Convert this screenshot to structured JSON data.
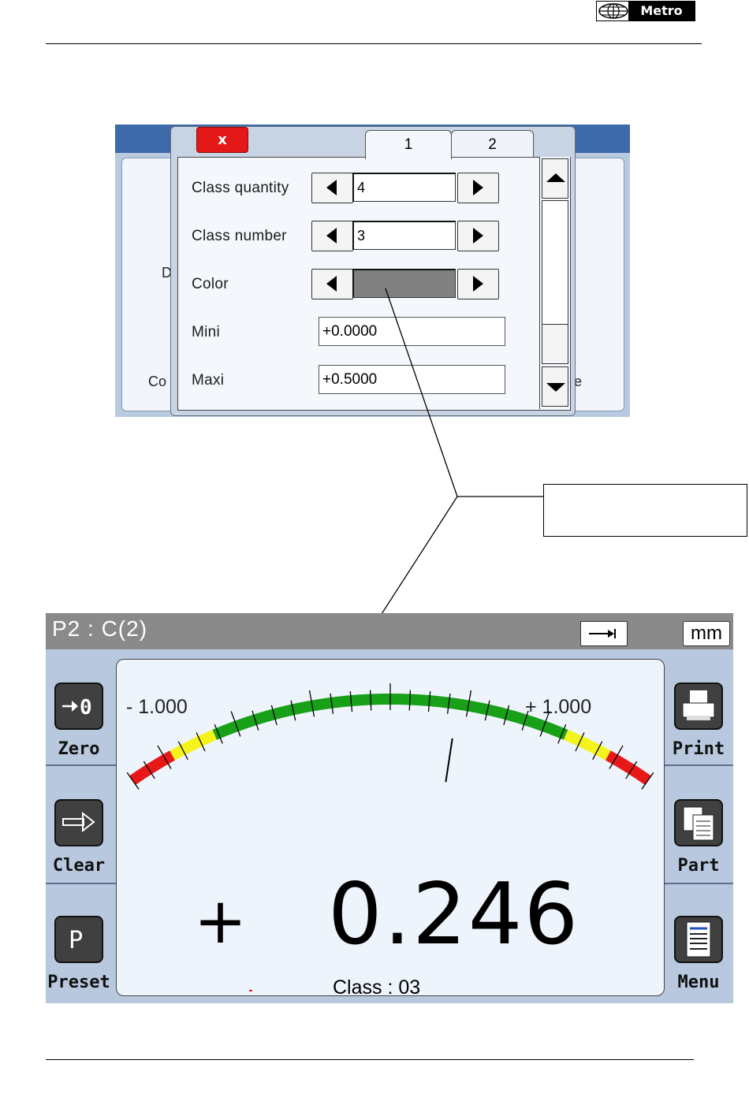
{
  "header": {
    "logo_text": "Metro"
  },
  "settings_dialog": {
    "close_label": "x",
    "tabs": [
      "1",
      "2"
    ],
    "background_texts": [
      "D",
      "Co",
      "e"
    ],
    "rows": {
      "class_quantity": {
        "label": "Class  quantity",
        "value": "4"
      },
      "class_number": {
        "label": "Class  number",
        "value": "3"
      },
      "color": {
        "label": "Color",
        "value_color": "#808080"
      },
      "mini": {
        "label": "Mini",
        "value": "+0.0000"
      },
      "maxi": {
        "label": "Maxi",
        "value": "+0.5000"
      }
    }
  },
  "callout": {
    "text": ""
  },
  "gauge_screen": {
    "title": "P2  :  C(2)",
    "unit": "mm",
    "arrow_button_icon": "right-arrow-to-bar-icon",
    "scale_min_label": "-   1.000",
    "scale_max_label": "+   1.000",
    "left_buttons": [
      {
        "label": "Zero",
        "icon": "zero-icon"
      },
      {
        "label": "Clear",
        "icon": "right-arrow-icon"
      },
      {
        "label": "Preset",
        "icon": "p-icon"
      }
    ],
    "right_buttons": [
      {
        "label": "Print",
        "icon": "printer-icon"
      },
      {
        "label": "Part",
        "icon": "copy-pages-icon"
      },
      {
        "label": "Menu",
        "icon": "menu-list-icon"
      }
    ],
    "reading_sign": "+",
    "reading_value": "0.246",
    "class_label": "Class  :  03",
    "class_count": 5,
    "active_class": 3,
    "colors": {
      "red": "#e81818",
      "yellow": "#f4f41c",
      "green": "#18a018",
      "class_active": "#18a018"
    },
    "needle_value": 0.246
  }
}
